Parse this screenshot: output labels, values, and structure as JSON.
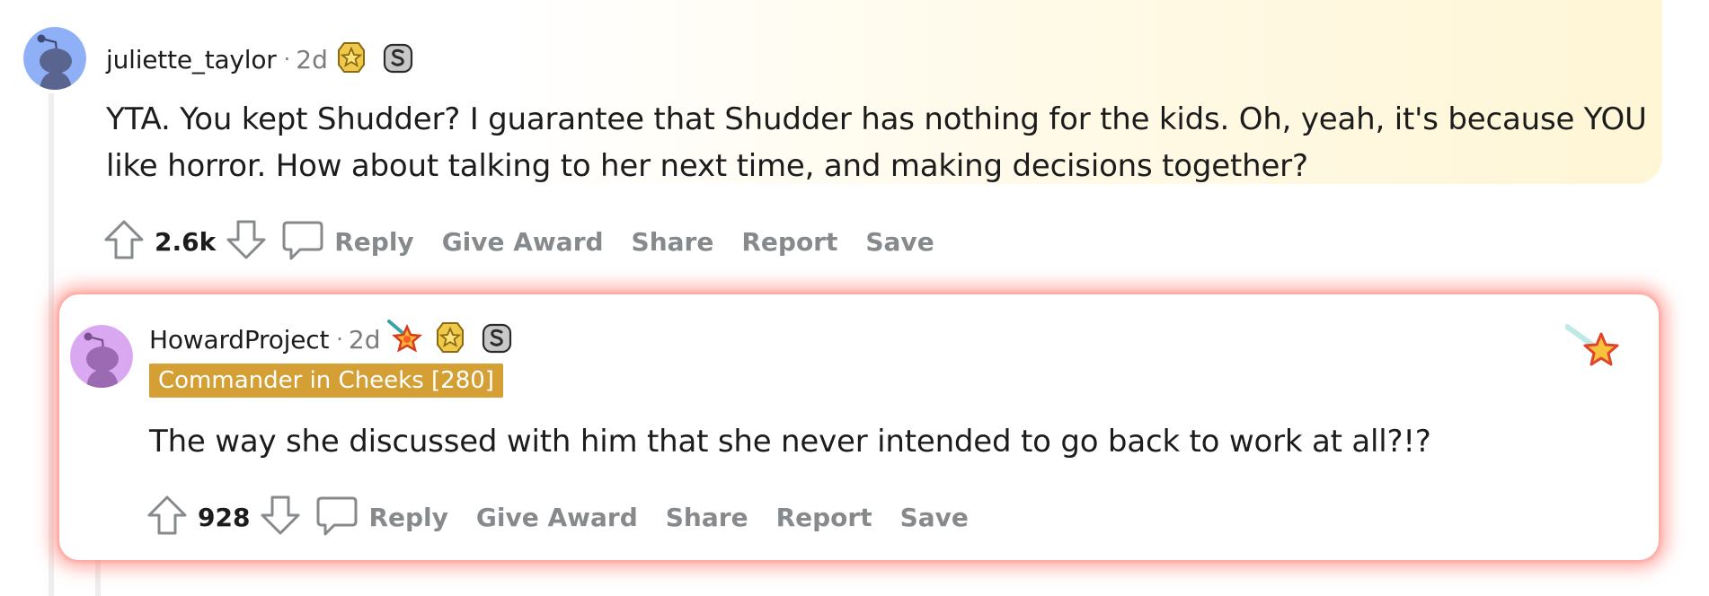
{
  "comments": [
    {
      "username": "juliette_taylor",
      "separator": "·",
      "age": "2d",
      "awards": [
        "gold-award-icon",
        "silver-award-icon"
      ],
      "body_line1": "YTA. You kept Shudder? I guarantee that Shudder has nothing for the kids. Oh, yeah, it's because YOU",
      "body_line2": "like horror. How about talking to her next time, and making decisions together?",
      "score": "2.6k",
      "actions": {
        "reply": "Reply",
        "give_award": "Give Award",
        "share": "Share",
        "report": "Report",
        "save": "Save"
      },
      "avatar_color": "#8fb0f7"
    },
    {
      "username": "HowardProject",
      "separator": "·",
      "age": "2d",
      "awards": [
        "rocket-star-award-icon",
        "gold-award-icon",
        "silver-award-icon"
      ],
      "flair": "Commander in Cheeks [280]",
      "body": "The way she discussed with him that she never intended to go back to work at all?!?",
      "score": "928",
      "actions": {
        "reply": "Reply",
        "give_award": "Give Award",
        "share": "Share",
        "report": "Report",
        "save": "Save"
      },
      "avatar_color": "#d9a8f0",
      "corner_award": "shooting-star-icon"
    }
  ],
  "colors": {
    "flair_bg": "#d4a035",
    "highlight_glow": "#ff786e",
    "action_gray": "#878a8c"
  }
}
